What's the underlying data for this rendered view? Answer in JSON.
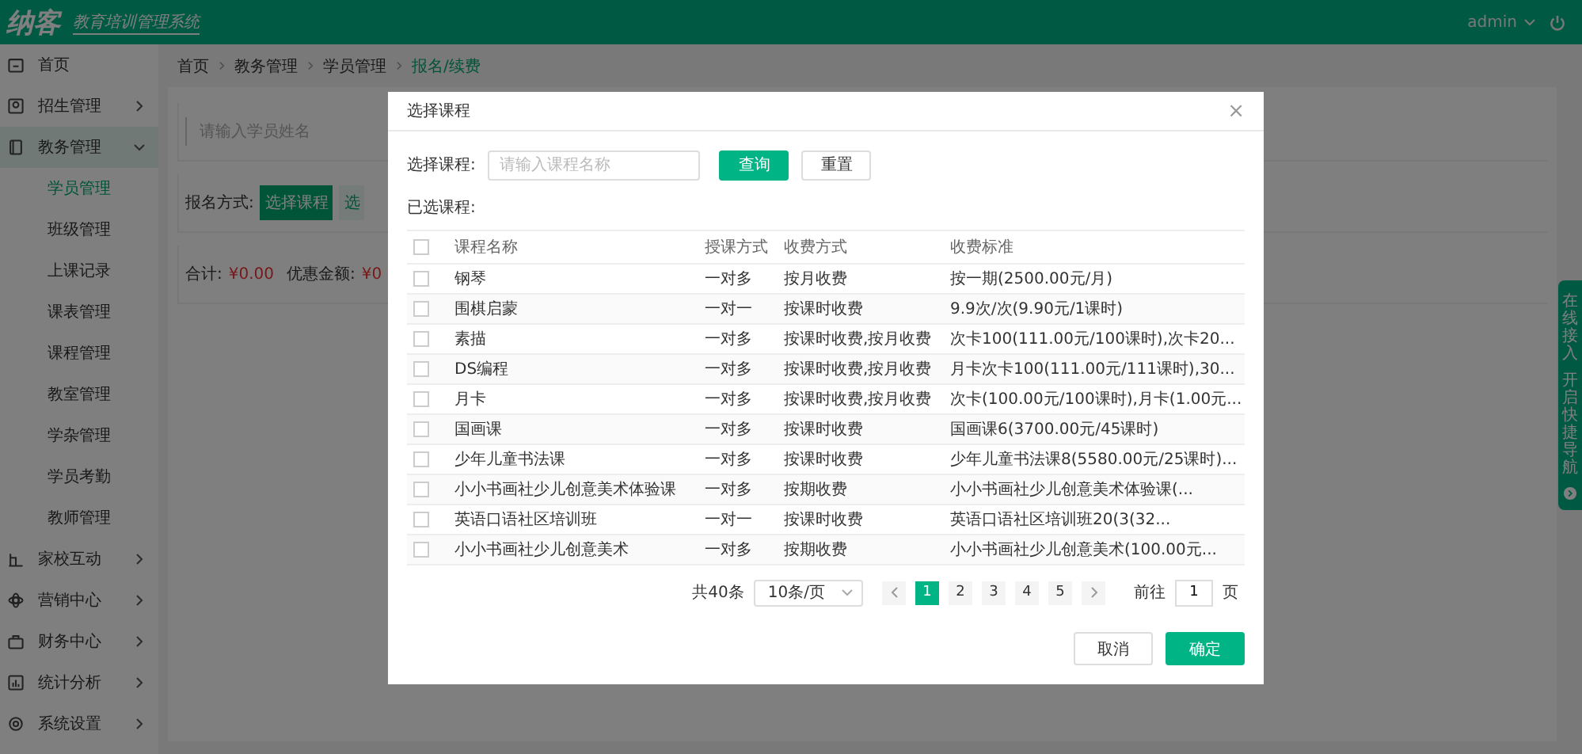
{
  "header": {
    "logo": "纳客",
    "tagline": "教育培训管理系统",
    "user": "admin"
  },
  "sidebar": {
    "items": [
      {
        "label": "首页",
        "selected": false
      },
      {
        "label": "招生管理",
        "selected": false,
        "expanded": false
      },
      {
        "label": "教务管理",
        "selected": true,
        "expanded": true,
        "children": [
          {
            "label": "学员管理",
            "selected": true
          },
          {
            "label": "班级管理",
            "selected": false
          },
          {
            "label": "上课记录",
            "selected": false
          },
          {
            "label": "课表管理",
            "selected": false
          },
          {
            "label": "课程管理",
            "selected": false
          },
          {
            "label": "教室管理",
            "selected": false
          },
          {
            "label": "学杂管理",
            "selected": false
          },
          {
            "label": "学员考勤",
            "selected": false
          },
          {
            "label": "教师管理",
            "selected": false
          }
        ]
      },
      {
        "label": "家校互动",
        "selected": false,
        "expanded": false
      },
      {
        "label": "营销中心",
        "selected": false,
        "expanded": false
      },
      {
        "label": "财务中心",
        "selected": false,
        "expanded": false
      },
      {
        "label": "统计分析",
        "selected": false,
        "expanded": false
      },
      {
        "label": "系统设置",
        "selected": false,
        "expanded": false
      }
    ]
  },
  "breadcrumb": [
    "首页",
    "教务管理",
    "学员管理",
    "报名/续费"
  ],
  "form": {
    "search_placeholder": "请输入学员姓名",
    "signup_label": "报名方式:",
    "buttons": [
      "选择课程",
      "选"
    ],
    "totals": [
      {
        "label": "合计:",
        "value": "¥0.00"
      },
      {
        "label": "优惠金额:",
        "value": "¥0"
      }
    ]
  },
  "modal": {
    "title": "选择课程",
    "close": "×",
    "filter_label": "选择课程:",
    "filter_placeholder": "请输入课程名称",
    "buttons": [
      "查询",
      "重置"
    ],
    "selected_label": "已选课程:",
    "table": {
      "select_all_checked": false,
      "columns": [
        "课程名称",
        "授课方式",
        "收费方式",
        "收费标准"
      ],
      "rows": [
        {
          "checked": false,
          "cells": [
            "钢琴",
            "一对多",
            "按月收费",
            "按一期(2500.00元/月)"
          ]
        },
        {
          "checked": false,
          "cells": [
            "围棋启蒙",
            "一对一",
            "按课时收费",
            "9.9次/次(9.90元/1课时)"
          ]
        },
        {
          "checked": false,
          "cells": [
            "素描",
            "一对多",
            "按课时收费,按月收费",
            "次卡100(111.00元/100课时),次卡20..."
          ]
        },
        {
          "checked": false,
          "cells": [
            "DS编程",
            "一对多",
            "按课时收费,按月收费",
            "月卡次卡100(111.00元/111课时),30..."
          ]
        },
        {
          "checked": false,
          "cells": [
            "月卡",
            "一对多",
            "按课时收费,按月收费",
            "次卡(100.00元/100课时),月卡(1.00元..."
          ]
        },
        {
          "checked": false,
          "cells": [
            "国画课",
            "一对多",
            "按课时收费",
            "国画课6(3700.00元/45课时)"
          ]
        },
        {
          "checked": false,
          "cells": [
            "少年儿童书法课",
            "一对多",
            "按课时收费",
            "少年儿童书法课8(5580.00元/25课时)..."
          ]
        },
        {
          "checked": false,
          "cells": [
            "小小书画社少儿创意美术体验课",
            "一对多",
            "按期收费",
            "小小书画社少儿创意美术体验课(..."
          ]
        },
        {
          "checked": false,
          "cells": [
            "英语口语社区培训班",
            "一对一",
            "按课时收费",
            "英语口语社区培训班20(3(32..."
          ]
        },
        {
          "checked": false,
          "cells": [
            "小小书画社少儿创意美术",
            "一对多",
            "按期收费",
            "小小书画社少儿创意美术(100.00元..."
          ]
        }
      ]
    },
    "pagination": {
      "total": "共40条",
      "page_size": "10条/页",
      "pages": [
        {
          "label": "1",
          "selected": true
        },
        {
          "label": "2",
          "selected": false
        },
        {
          "label": "3",
          "selected": false
        },
        {
          "label": "4",
          "selected": false
        },
        {
          "label": "5",
          "selected": false
        }
      ],
      "goto_label": "前往",
      "goto_value": "1",
      "goto_suffix": "页"
    },
    "footer_buttons": [
      {
        "label": "取消",
        "kind": "default"
      },
      {
        "label": "确定",
        "kind": "primary"
      }
    ]
  },
  "side_tab": {
    "texts": [
      "在线接入",
      "开启快捷导航"
    ]
  }
}
